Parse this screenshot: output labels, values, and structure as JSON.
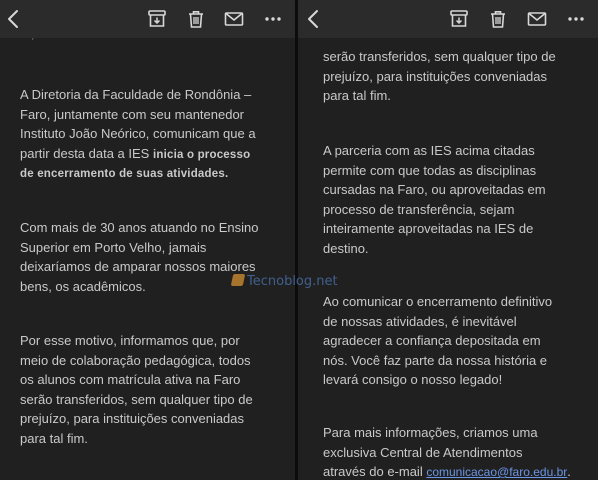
{
  "left": {
    "cut_text": "...,",
    "paragraphs": [
      [
        "A Diretoria da Faculdade de Rondônia –",
        "Faro, juntamente com seu mantenedor",
        "Instituto João Neórico, comunicam que a",
        [
          "partir desta data a IES ",
          "inicia o processo"
        ],
        "de encerramento de suas atividades."
      ],
      [
        "Com mais de 30 anos atuando no Ensino",
        "Superior em Porto Velho, jamais",
        "deixaríamos de amparar nossos maiores",
        "bens, os acadêmicos."
      ],
      [
        "Por esse motivo, informamos que, por",
        "meio de colaboração pedagógica, todos",
        "os alunos com matrícula ativa na Faro",
        "serão transferidos, sem qualquer tipo de",
        "prejuízo, para instituições conveniadas",
        "para tal fim."
      ]
    ]
  },
  "right": {
    "paragraphs": [
      [
        "serão transferidos, sem qualquer tipo de",
        "prejuízo, para instituições conveniadas",
        "para tal fim."
      ],
      [
        "A parceria com as IES acima citadas",
        "permite com que todas as disciplinas",
        "cursadas na Faro, ou aproveitadas em",
        "processo de transferência, sejam",
        "inteiramente aproveitadas na IES de",
        "destino."
      ],
      [
        "Ao comunicar o encerramento definitivo",
        "de nossas atividades, é inevitável",
        "agradecer a confiança depositada em",
        "nós. Você faz parte da nossa história e",
        "levará consigo o nosso legado!"
      ],
      [
        "Para mais informações, criamos uma",
        "exclusiva Central de Atendimentos",
        [
          "através do e-mail ",
          "comunicacao@faro.edu.br",
          "."
        ]
      ]
    ]
  },
  "watermark": "Tecnoblog.net",
  "toolbar": {
    "icons": [
      "back-icon",
      "archive-icon",
      "trash-icon",
      "mail-icon",
      "more-icon"
    ]
  },
  "colors": {
    "background": "#202020",
    "toolbar": "#2b2b2b",
    "text": "#c9c9c9",
    "link": "#6b95e6"
  }
}
